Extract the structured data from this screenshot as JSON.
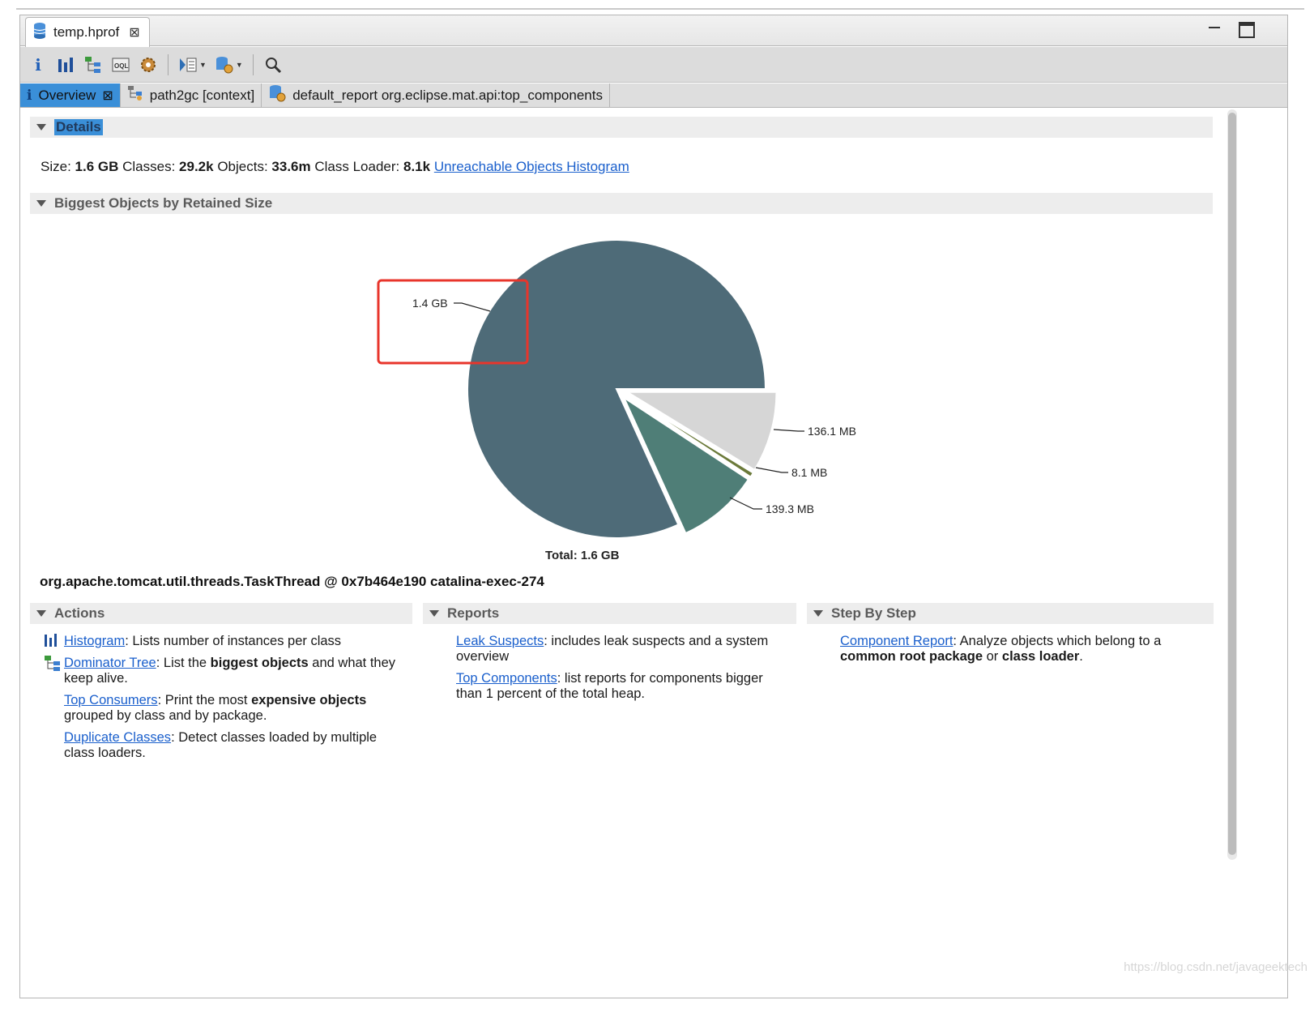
{
  "editor": {
    "file_tab": "temp.hprof"
  },
  "toolbar": {
    "icons": [
      "info-icon",
      "histogram-icon",
      "dominator-tree-icon",
      "oql-icon",
      "thread-overview-icon",
      "query-browser-icon",
      "reports-icon",
      "search-icon"
    ]
  },
  "subtabs": [
    {
      "label": "Overview",
      "icon": "info-icon"
    },
    {
      "label": "path2gc [context]",
      "icon": "path2gc-icon"
    },
    {
      "label": "default_report  org.eclipse.mat.api:top_components",
      "icon": "report-icon"
    }
  ],
  "details": {
    "header": "Details",
    "size_label": "Size:",
    "size_value": "1.6 GB",
    "classes_label": "Classes:",
    "classes_value": "29.2k",
    "objects_label": "Objects:",
    "objects_value": "33.6m",
    "loader_label": "Class Loader:",
    "loader_value": "8.1k",
    "link": "Unreachable Objects Histogram"
  },
  "biggest": {
    "header": "Biggest Objects by Retained Size",
    "total_label": "Total: 1.6 GB",
    "selected_object": "org.apache.tomcat.util.threads.TaskThread @ 0x7b464e190 catalina-exec-274"
  },
  "chart_data": {
    "type": "pie",
    "slices": [
      {
        "label": "1.4 GB",
        "value_mb": 1274.5,
        "color": "#4e6b78"
      },
      {
        "label": "139.3 MB",
        "value_mb": 139.3,
        "color": "#4f7e77"
      },
      {
        "label": "8.1 MB",
        "value_mb": 8.1,
        "color": "#6b7a3a"
      },
      {
        "label": "136.1 MB",
        "value_mb": 136.1,
        "color": "#d6d6d6"
      }
    ],
    "highlight": {
      "slice": "1.4 GB",
      "color": "#e8352b"
    },
    "total": "Total: 1.6 GB"
  },
  "actions": {
    "header": "Actions",
    "items": [
      {
        "icon": "histogram-icon",
        "link": "Histogram",
        "desc": ": Lists number of instances per class",
        "bold": "",
        "desc2": ""
      },
      {
        "icon": "dominator-tree-icon",
        "link": "Dominator Tree",
        "desc": ": List the ",
        "bold": "biggest objects",
        "desc2": " and what they keep alive."
      },
      {
        "icon": "",
        "link": "Top Consumers",
        "desc": ": Print the most ",
        "bold": "expensive objects",
        "desc2": " grouped by class and by package."
      },
      {
        "icon": "",
        "link": "Duplicate Classes",
        "desc": ": Detect classes loaded by multiple class loaders.",
        "bold": "",
        "desc2": ""
      }
    ]
  },
  "reports": {
    "header": "Reports",
    "items": [
      {
        "link": "Leak Suspects",
        "desc": ": includes leak suspects and a system overview"
      },
      {
        "link": "Top Components",
        "desc": ": list reports for components bigger than 1 percent of the total heap."
      }
    ]
  },
  "steps": {
    "header": "Step By Step",
    "link": "Component Report",
    "desc": ": Analyze objects which belong to a ",
    "bold1": "common root package",
    "mid": " or ",
    "bold2": "class loader",
    "end": "."
  },
  "watermark": "https://blog.csdn.net/javageektech"
}
